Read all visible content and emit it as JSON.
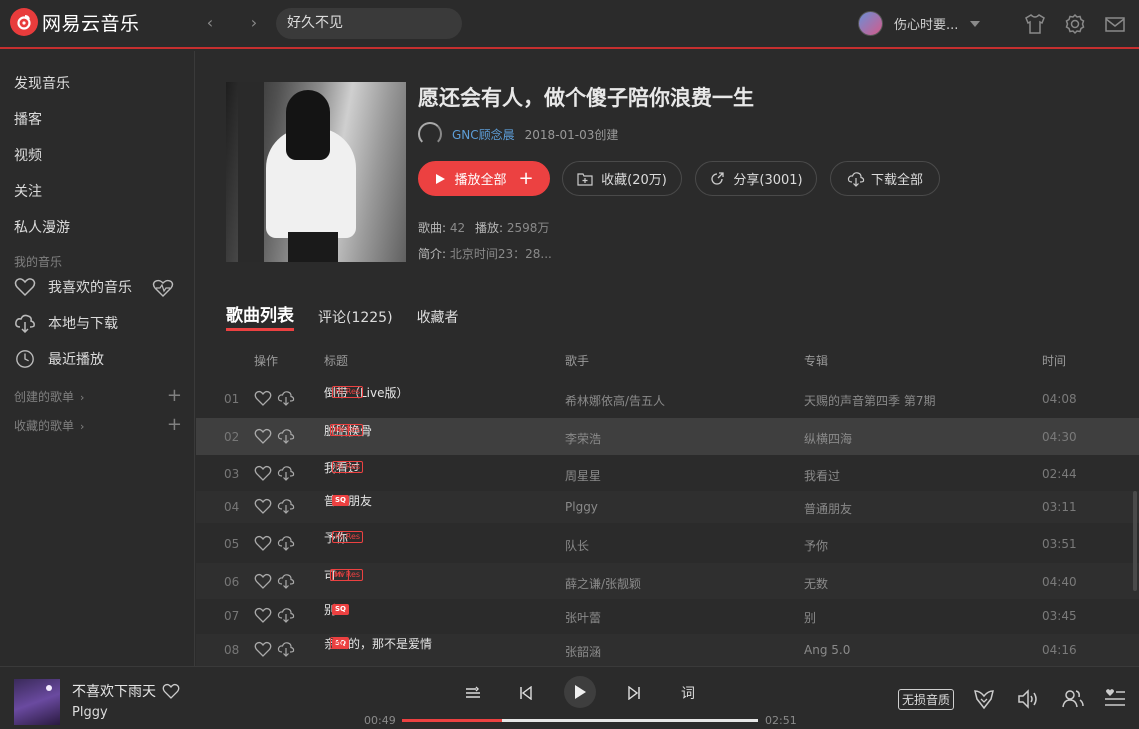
{
  "app": {
    "name": "网易云音乐",
    "brand_color": "#ec4141"
  },
  "search": {
    "value": "好久不见"
  },
  "user": {
    "name": "伤心时要..."
  },
  "sidebar": {
    "items": [
      {
        "label": "发现音乐"
      },
      {
        "label": "播客"
      },
      {
        "label": "视频"
      },
      {
        "label": "关注"
      },
      {
        "label": "私人漫游"
      }
    ],
    "my_music_section": "我的音乐",
    "my_music": [
      {
        "label": "我喜欢的音乐",
        "icon": "heart-icon"
      },
      {
        "label": "本地与下载",
        "icon": "cloud-download-icon"
      },
      {
        "label": "最近播放",
        "icon": "clock-icon"
      }
    ],
    "created_lists": "创建的歌单",
    "collected_lists": "收藏的歌单"
  },
  "playlist": {
    "title": "愿还会有人，做个傻子陪你浪费一生",
    "creator": "GNC顾念晨",
    "created": "2018-01-03创建",
    "play_all": "播放全部",
    "collect": "收藏(20万)",
    "share": "分享(3001)",
    "download_all": "下载全部",
    "songs_label": "歌曲:",
    "songs_count": "42",
    "plays_label": "播放:",
    "plays_count": "2598万",
    "intro_label": "简介:",
    "intro_text": "北京时间23：28..."
  },
  "tabs": [
    {
      "label": "歌曲列表",
      "active": true
    },
    {
      "label": "评论(1225)",
      "active": false
    },
    {
      "label": "收藏者",
      "active": false
    }
  ],
  "table": {
    "headers": {
      "ops": "操作",
      "title": "标题",
      "artist": "歌手",
      "album": "专辑",
      "time": "时间"
    },
    "rows": [
      {
        "num": "01",
        "title": "倒带（Live版）",
        "badges": [
          "hires"
        ],
        "artist": "希林娜依高/告五人",
        "album": "天赐的声音第四季 第7期",
        "time": "04:08"
      },
      {
        "num": "02",
        "title": "脱胎换骨",
        "badges": [
          "hires",
          "mv"
        ],
        "artist": "李荣浩",
        "album": "纵横四海",
        "time": "04:30",
        "selected": true
      },
      {
        "num": "03",
        "title": "我看过",
        "badges": [
          "hires"
        ],
        "artist": "周星星",
        "album": "我看过",
        "time": "02:44"
      },
      {
        "num": "04",
        "title": "普通朋友",
        "badges": [
          "sq"
        ],
        "artist": "Plggy",
        "album": "普通朋友",
        "time": "03:11"
      },
      {
        "num": "05",
        "title": "予你",
        "badges": [
          "hires"
        ],
        "artist": "队长",
        "album": "予你",
        "time": "03:51"
      },
      {
        "num": "06",
        "title": "可",
        "badges": [
          "hires",
          "mv"
        ],
        "artist": "薛之谦/张靓颖",
        "album": "无数",
        "time": "04:40"
      },
      {
        "num": "07",
        "title": "别",
        "badges": [
          "sq"
        ],
        "artist": "张叶蕾",
        "album": "别",
        "time": "03:45"
      },
      {
        "num": "08",
        "title": "亲爱的，那不是爱情",
        "badges": [
          "sq",
          "mv"
        ],
        "artist": "张韶涵",
        "album": "Ang 5.0",
        "time": "04:16"
      }
    ],
    "badge_text": {
      "hires": "Hi Res",
      "sq": "SQ",
      "mv": "MV"
    }
  },
  "player": {
    "title": "不喜欢下雨天",
    "artist": "Plggy",
    "current": "00:49",
    "total": "02:51",
    "progress": 0.28,
    "lyrics_button": "词",
    "quality": "无损音质"
  }
}
